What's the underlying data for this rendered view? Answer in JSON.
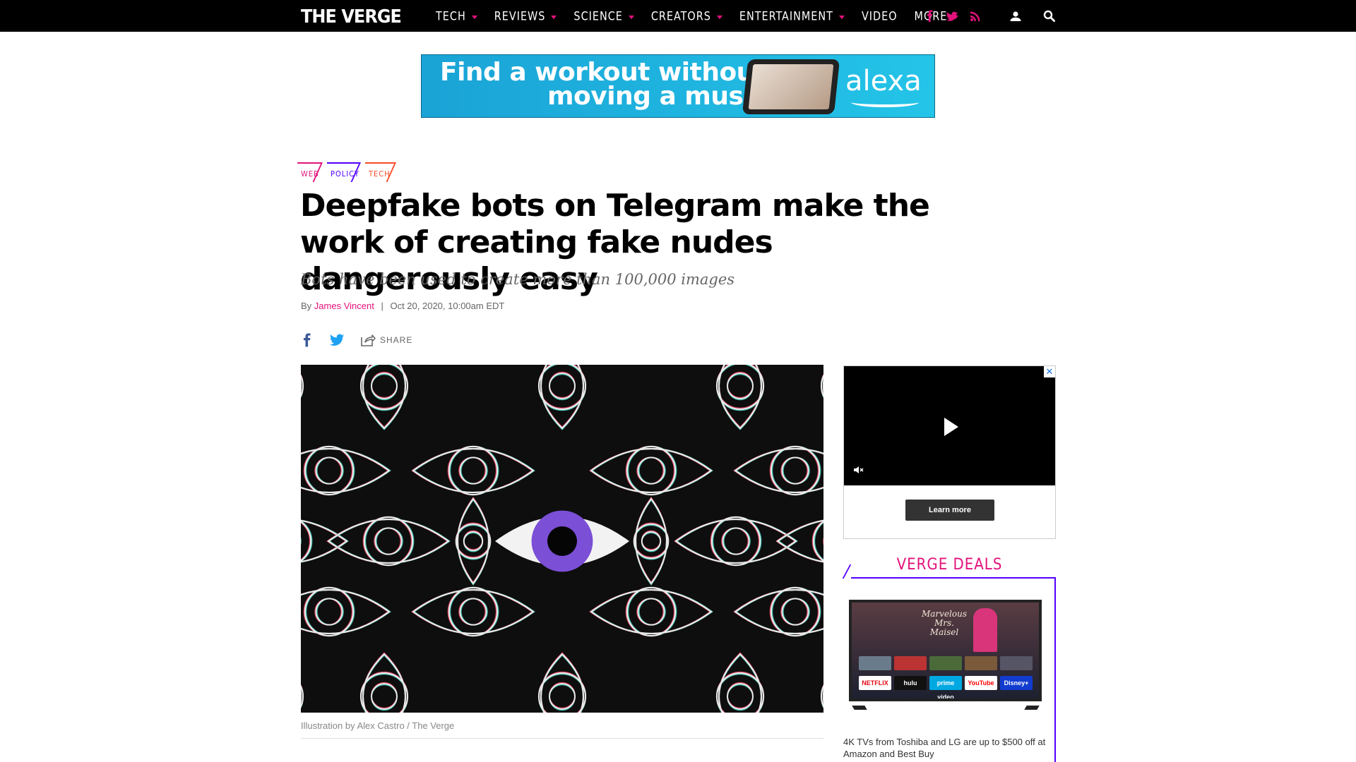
{
  "nav": {
    "logo": "THE VERGE",
    "items": [
      {
        "label": "TECH",
        "dropdown": true
      },
      {
        "label": "REVIEWS",
        "dropdown": true
      },
      {
        "label": "SCIENCE",
        "dropdown": true
      },
      {
        "label": "CREATORS",
        "dropdown": true
      },
      {
        "label": "ENTERTAINMENT",
        "dropdown": true
      },
      {
        "label": "VIDEO",
        "dropdown": false
      },
      {
        "label": "MORE",
        "dropdown": true
      }
    ],
    "icons": [
      "facebook-icon",
      "twitter-icon",
      "rss-icon",
      "user-icon",
      "search-icon"
    ],
    "accent_color": "#e2127a"
  },
  "ad_banner": {
    "line1": "Find a workout without",
    "line2": "moving a muscle",
    "brand": "alexa"
  },
  "tags": [
    {
      "label": "WEB",
      "color": "#e2127a"
    },
    {
      "label": "POLICY",
      "color": "#5200ff"
    },
    {
      "label": "TECH",
      "color": "#fa4b2a"
    }
  ],
  "article": {
    "headline": "Deepfake bots on Telegram make the work of creating fake nudes dangerously easy",
    "dek": "Bots have been used to create more than 100,000 images",
    "by_label": "By",
    "author": "James Vincent",
    "separator": "|",
    "date": "Oct 20, 2020, 10:00am EDT",
    "share_label": "SHARE",
    "caption": "Illustration by Alex Castro / The Verge"
  },
  "sidebar": {
    "video_ad": {
      "close_label": "✕",
      "learn_more_label": "Learn more"
    },
    "deals": {
      "title": "VERGE DEALS",
      "tv_tiles": [
        "NETFLIX",
        "hulu",
        "prime video",
        "YouTube",
        "Disney+"
      ],
      "tv_show_title": "Marvelous Mrs. Maisel",
      "description": "4K TVs from Toshiba and LG are up to $500 off at Amazon and Best Buy"
    }
  }
}
